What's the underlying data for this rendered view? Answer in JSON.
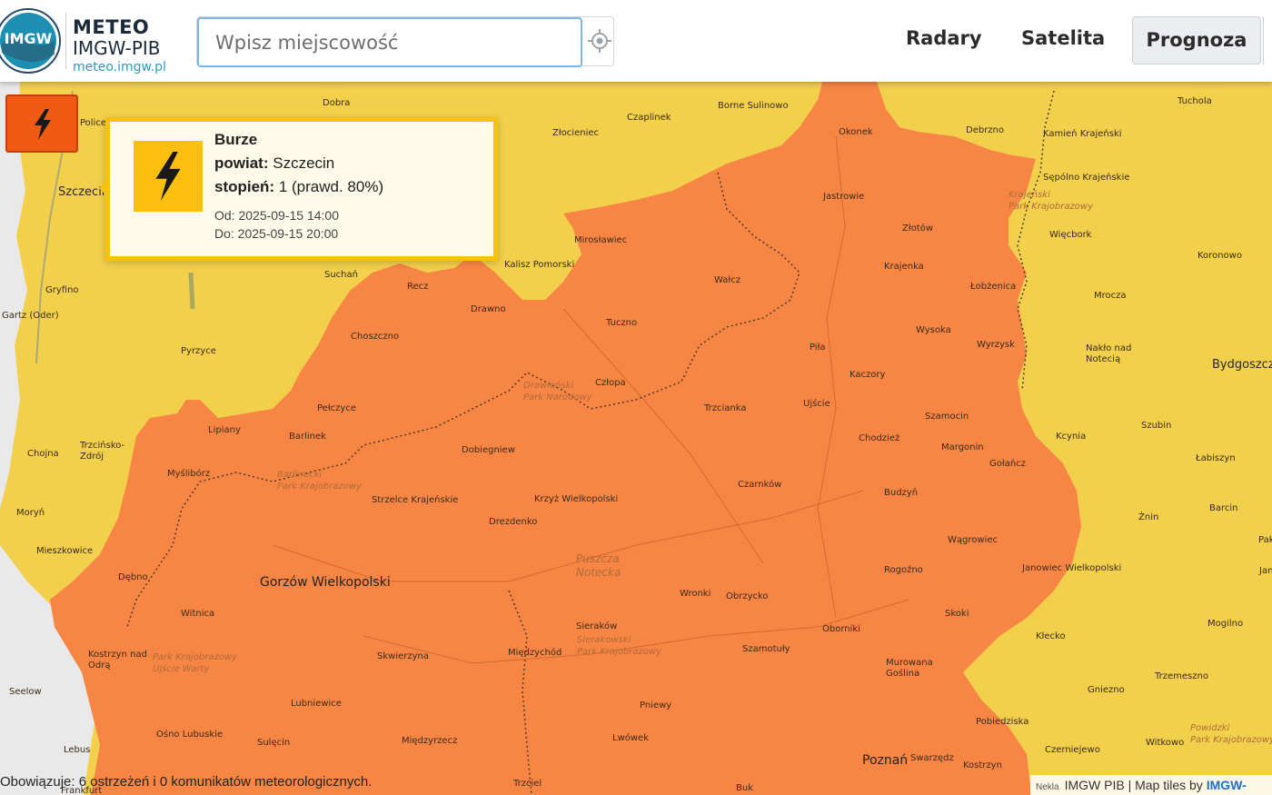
{
  "header": {
    "brand_title": "METEO",
    "brand_sub": "IMGW-PIB",
    "brand_url": "meteo.imgw.pl",
    "logo_text": "IMGW",
    "search": {
      "placeholder": "Wpisz miejscowość",
      "value": ""
    },
    "nav": {
      "radary": "Radary",
      "satelita": "Satelita",
      "prognoza": "Prognoza"
    }
  },
  "warning_button": {
    "icon": "lightning-icon",
    "color": "#f05a12"
  },
  "popup": {
    "title": "Burze",
    "powiat_label": "powiat:",
    "powiat_value": "Szczecin",
    "stopien_label": "stopień:",
    "stopien_value": "1 (prawd. 80%)",
    "od": "Od: 2025-09-15 14:00",
    "do": "Do: 2025-09-15 20:00",
    "icon": "lightning-icon",
    "icon_color": "#fcbf10"
  },
  "map": {
    "colors": {
      "land": "#f2d04c",
      "warning_zone": "#f78645",
      "neighbor": "#e8e8e8"
    },
    "places": [
      {
        "id": "dobra",
        "text": "Dobra"
      },
      {
        "id": "czaplinek",
        "text": "Czaplinek"
      },
      {
        "id": "borne",
        "text": "Borne Sulinowo"
      },
      {
        "id": "zlocieniec",
        "text": "Złocieniec"
      },
      {
        "id": "tuchola",
        "text": "Tuchola"
      },
      {
        "id": "okonek",
        "text": "Okonek"
      },
      {
        "id": "debrzno",
        "text": "Debrzno"
      },
      {
        "id": "kamien",
        "text": "Kamień Krajeński"
      },
      {
        "id": "sepolno",
        "text": "Sępólno Krajeńskie"
      },
      {
        "id": "jastrowie",
        "text": "Jastrowie"
      },
      {
        "id": "zlotow",
        "text": "Złotów"
      },
      {
        "id": "wiecbork",
        "text": "Więcbork"
      },
      {
        "id": "koronowo",
        "text": "Koronowo"
      },
      {
        "id": "miroslawiec",
        "text": "Mirosławiec"
      },
      {
        "id": "kalisz",
        "text": "Kalisz Pomorski"
      },
      {
        "id": "suchan",
        "text": "Suchań"
      },
      {
        "id": "recz",
        "text": "Recz"
      },
      {
        "id": "walcz",
        "text": "Wałcz"
      },
      {
        "id": "krajenka",
        "text": "Krajenka"
      },
      {
        "id": "lobzenica",
        "text": "Łobżenica"
      },
      {
        "id": "mrocza",
        "text": "Mrocza"
      },
      {
        "id": "gryfino",
        "text": "Gryfino"
      },
      {
        "id": "gartz",
        "text": "Gartz (Oder)"
      },
      {
        "id": "drawno",
        "text": "Drawno"
      },
      {
        "id": "tuczno",
        "text": "Tuczno"
      },
      {
        "id": "choszczno",
        "text": "Choszczno"
      },
      {
        "id": "wysoka",
        "text": "Wysoka"
      },
      {
        "id": "wyrzysk",
        "text": "Wyrzysk"
      },
      {
        "id": "naklo",
        "text": "Nakło nad Notecią"
      },
      {
        "id": "bydgoszcz",
        "text": "Bydgoszcz"
      },
      {
        "id": "pyrzyce",
        "text": "Pyrzyce"
      },
      {
        "id": "pila",
        "text": "Piła"
      },
      {
        "id": "kaczory",
        "text": "Kaczory"
      },
      {
        "id": "czlopa",
        "text": "Człopa"
      },
      {
        "id": "ujscie",
        "text": "Ujście"
      },
      {
        "id": "trzcianka",
        "text": "Trzcianka"
      },
      {
        "id": "pelczyce",
        "text": "Pełczyce"
      },
      {
        "id": "szamocin",
        "text": "Szamocin"
      },
      {
        "id": "lipiany",
        "text": "Lipiany"
      },
      {
        "id": "barlinek",
        "text": "Barlinek"
      },
      {
        "id": "chodziez",
        "text": "Chodzież"
      },
      {
        "id": "margonin",
        "text": "Margonin"
      },
      {
        "id": "szubin",
        "text": "Szubin"
      },
      {
        "id": "kcynia",
        "text": "Kcynia"
      },
      {
        "id": "chojna",
        "text": "Chojna"
      },
      {
        "id": "trzcinsko",
        "text": "Trzcińsko-\nZdrój"
      },
      {
        "id": "dobiegniew",
        "text": "Dobiegniew"
      },
      {
        "id": "golancz",
        "text": "Gołańcz"
      },
      {
        "id": "labiszyn",
        "text": "Łabiszyn"
      },
      {
        "id": "mysliborz",
        "text": "Myślibórz"
      },
      {
        "id": "czarnkow",
        "text": "Czarnków"
      },
      {
        "id": "budzyn",
        "text": "Budzyń"
      },
      {
        "id": "strzelce",
        "text": "Strzelce Krajeńskie"
      },
      {
        "id": "krzyz",
        "text": "Krzyż Wielkopolski"
      },
      {
        "id": "barcin",
        "text": "Barcin"
      },
      {
        "id": "moryn",
        "text": "Moryń"
      },
      {
        "id": "znin",
        "text": "Żnin"
      },
      {
        "id": "drezdenko",
        "text": "Drezdenko"
      },
      {
        "id": "wagrowiec",
        "text": "Wągrowiec"
      },
      {
        "id": "mieszkowice",
        "text": "Mieszkowice"
      },
      {
        "id": "pak",
        "text": "Pak"
      },
      {
        "id": "rogozno",
        "text": "Rogoźno"
      },
      {
        "id": "janowiec",
        "text": "Janowiec Wielkopolski"
      },
      {
        "id": "debno",
        "text": "Dębno"
      },
      {
        "id": "jan",
        "text": "Jan"
      },
      {
        "id": "gorzow",
        "text": "Gorzów Wielkopolski"
      },
      {
        "id": "wronki",
        "text": "Wronki"
      },
      {
        "id": "obrzycko",
        "text": "Obrzycko"
      },
      {
        "id": "witnica",
        "text": "Witnica"
      },
      {
        "id": "skoki",
        "text": "Skoki"
      },
      {
        "id": "mogilno",
        "text": "Mogilno"
      },
      {
        "id": "sierakow",
        "text": "Sieraków"
      },
      {
        "id": "oborniki",
        "text": "Oborniki"
      },
      {
        "id": "kostrzyn",
        "text": "Kostrzyn nad\nOdrą"
      },
      {
        "id": "kleck",
        "text": "Kłecko"
      },
      {
        "id": "miedzychod",
        "text": "Międzychód"
      },
      {
        "id": "szamotuly",
        "text": "Szamotuły"
      },
      {
        "id": "skwierzyna",
        "text": "Skwierzyna"
      },
      {
        "id": "murowana",
        "text": "Murowana\nGoślina"
      },
      {
        "id": "trzemeszno",
        "text": "Trzemeszno"
      },
      {
        "id": "seelow",
        "text": "Seelow"
      },
      {
        "id": "gniezno",
        "text": "Gniezno"
      },
      {
        "id": "lubniewice",
        "text": "Lubniewice"
      },
      {
        "id": "pniewy",
        "text": "Pniewy"
      },
      {
        "id": "osno",
        "text": "Ośno Lubuskie"
      },
      {
        "id": "pobiedziska",
        "text": "Pobiedziska"
      },
      {
        "id": "lwowek",
        "text": "Lwówek"
      },
      {
        "id": "sulecin",
        "text": "Sulęcin"
      },
      {
        "id": "miedzyrzecz",
        "text": "Międzyrzecz"
      },
      {
        "id": "czerniejewo",
        "text": "Czerniejewo"
      },
      {
        "id": "witkowo",
        "text": "Witkowo"
      },
      {
        "id": "lebus",
        "text": "Lebus"
      },
      {
        "id": "poznan",
        "text": "Poznań"
      },
      {
        "id": "swarzedz",
        "text": "Swarzędz"
      },
      {
        "id": "kostrzyn2",
        "text": "Kostrzyn"
      },
      {
        "id": "buk",
        "text": "Buk"
      },
      {
        "id": "trzciel",
        "text": "Trzciel"
      },
      {
        "id": "frankfurt",
        "text": "Frankfurt"
      },
      {
        "id": "szczecin",
        "text": "Szczecin"
      },
      {
        "id": "police",
        "text": "Police"
      }
    ],
    "parks": [
      {
        "id": "park-krajenski",
        "text": "Krajeński\nPark Krajobrazowy"
      },
      {
        "id": "park-drawienski",
        "text": "Drawieński\nPark Narodowy"
      },
      {
        "id": "park-barlinecki",
        "text": "Barlinecki\nPark Krajobrazowy"
      },
      {
        "id": "park-puszcza",
        "text": "Puszcza\nNotecka"
      },
      {
        "id": "park-sierakowski",
        "text": "Sierakowski\nPark Krajobrazowy"
      },
      {
        "id": "park-ujscie",
        "text": "Park Krajobrazowy\nUjście Warty"
      },
      {
        "id": "park-powidzki",
        "text": "Powidzki\nPark Krajobrazowy"
      }
    ]
  },
  "footer": {
    "status": "Obowiązuje: 6 ostrzeżeń i 0 komunikatów meteorologicznych.",
    "attr_small": "Nekla",
    "attr_main": "IMGW PIB | Map tiles by ",
    "attr_link": "IMGW-"
  }
}
